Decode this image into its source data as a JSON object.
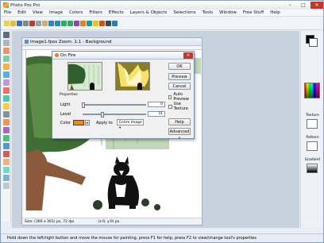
{
  "app": {
    "title": "Photo Pos Pro"
  },
  "window_controls": {
    "minimize": "–",
    "maximize": "□",
    "close": "✕"
  },
  "menu": [
    "File",
    "Edit",
    "View",
    "Image",
    "Colors",
    "Filters",
    "Effects",
    "Layers & Objects",
    "Selections",
    "Tools",
    "Window",
    "Free Stuff",
    "Help"
  ],
  "document": {
    "title": "Image1.fpos  Zoom: 1:1 - Background",
    "status_size": "Size: (300 x 301) px, 72 dpi",
    "status_pos": "(x:0, y:0) px"
  },
  "dialog": {
    "title": "On Fire",
    "close": "✕",
    "group_label": "Properties",
    "light_label": "Light",
    "light_value": "0",
    "light_level": 0,
    "level_label": "Level",
    "level_value": "31",
    "level_level": 0.31,
    "color_label": "Color",
    "color_value": "#e8891c",
    "dropdown_arrow": "▾",
    "apply_label": "Apply to",
    "apply_value": "Entire Image",
    "ok": "OK",
    "preview": "Preview",
    "cancel": "Cancel",
    "auto_preview": "Auto Preview",
    "use_texture": "Use Texture",
    "help": "Help",
    "advanced": "Advanced »"
  },
  "right_panel": {
    "texture_label": "Texture",
    "pattern_label": "Pattern",
    "gradient_label": "Gradient"
  },
  "status": {
    "text": "Hold down the left/right button and move the mouse for painting, press F1 for help, press F2 to view/change tool's properties"
  }
}
